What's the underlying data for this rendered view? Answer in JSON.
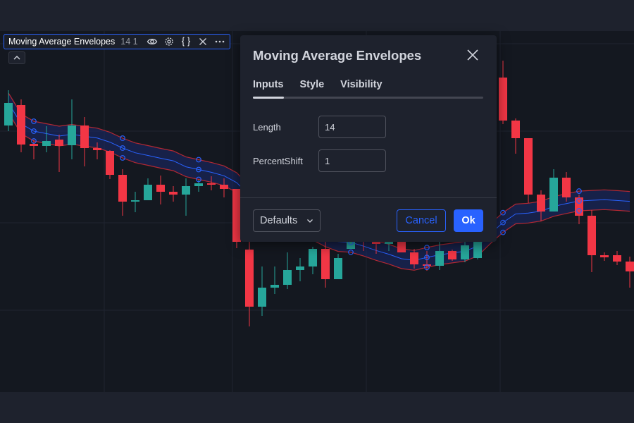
{
  "legend": {
    "name": "Moving Average Envelopes",
    "params": "14 1",
    "icons": [
      "eye-icon",
      "gear-icon",
      "code-braces-icon",
      "close-icon",
      "more-icon"
    ]
  },
  "dialog": {
    "title": "Moving Average Envelopes",
    "tabs": [
      {
        "label": "Inputs",
        "active": true
      },
      {
        "label": "Style",
        "active": false
      },
      {
        "label": "Visibility",
        "active": false
      }
    ],
    "fields": [
      {
        "label": "Length",
        "value": "14"
      },
      {
        "label": "PercentShift",
        "value": "1"
      }
    ],
    "defaults_label": "Defaults",
    "cancel_label": "Cancel",
    "ok_label": "Ok"
  },
  "colors": {
    "bull": "#26a69a",
    "bear": "#f23645",
    "envelope": "#b22833",
    "band_fill": "#1a2a6c",
    "basis": "#2962ff",
    "accent": "#2962ff",
    "dialog_bg": "#1e222d",
    "chart_bg": "#141820"
  },
  "chart_data": {
    "type": "candlestick",
    "y_axis": "price (unlabeled)",
    "candles": [
      {
        "o": 128,
        "c": 160,
        "h": 178,
        "l": 120
      },
      {
        "o": 157,
        "c": 101,
        "h": 165,
        "l": 90
      },
      {
        "o": 102,
        "c": 99,
        "h": 108,
        "l": 80
      },
      {
        "o": 99,
        "c": 106,
        "h": 127,
        "l": 90
      },
      {
        "o": 108,
        "c": 99,
        "h": 115,
        "l": 62
      },
      {
        "o": 100,
        "c": 128,
        "h": 165,
        "l": 80
      },
      {
        "o": 128,
        "c": 96,
        "h": 140,
        "l": 70
      },
      {
        "o": 96,
        "c": 93,
        "h": 104,
        "l": 80
      },
      {
        "o": 92,
        "c": 58,
        "h": 93,
        "l": 52
      },
      {
        "o": 58,
        "c": 20,
        "h": 66,
        "l": 0
      },
      {
        "o": 20,
        "c": 22,
        "h": 34,
        "l": 5
      },
      {
        "o": 22,
        "c": 44,
        "h": 53,
        "l": 22
      },
      {
        "o": 44,
        "c": 34,
        "h": 57,
        "l": 16
      },
      {
        "o": 34,
        "c": 30,
        "h": 42,
        "l": 20
      },
      {
        "o": 30,
        "c": 42,
        "h": 53,
        "l": 0
      },
      {
        "o": 42,
        "c": 46,
        "h": 51,
        "l": 34
      },
      {
        "o": 46,
        "c": 44,
        "h": 56,
        "l": 36
      },
      {
        "o": 44,
        "c": 38,
        "h": 53,
        "l": 26
      },
      {
        "o": 38,
        "c": -37,
        "h": 38,
        "l": -46
      },
      {
        "o": -48,
        "c": -129,
        "h": -14,
        "l": -157
      },
      {
        "o": -129,
        "c": -102,
        "h": -72,
        "l": -142
      },
      {
        "o": -102,
        "c": -98,
        "h": -72,
        "l": -111
      },
      {
        "o": -98,
        "c": -77,
        "h": -52,
        "l": -104
      },
      {
        "o": -77,
        "c": -72,
        "h": -60,
        "l": -93
      },
      {
        "o": -72,
        "c": -47,
        "h": -44,
        "l": -83
      },
      {
        "o": -47,
        "c": -90,
        "h": -35,
        "l": -102
      },
      {
        "o": -90,
        "c": -60,
        "h": -54,
        "l": -90
      },
      {
        "o": -47,
        "c": 13,
        "h": 21,
        "l": -47
      },
      {
        "o": 13,
        "c": -33,
        "h": 21,
        "l": -50
      },
      {
        "o": 13,
        "c": -40,
        "h": 18,
        "l": -54
      },
      {
        "o": -40,
        "c": -30,
        "h": -14,
        "l": -50
      },
      {
        "o": -30,
        "c": -52,
        "h": -6,
        "l": -52
      },
      {
        "o": -52,
        "c": -69,
        "h": -47,
        "l": -75
      },
      {
        "o": -69,
        "c": -71,
        "h": -50,
        "l": -78
      },
      {
        "o": -71,
        "c": -50,
        "h": -35,
        "l": -77
      },
      {
        "o": -50,
        "c": -62,
        "h": -48,
        "l": -64
      },
      {
        "o": -62,
        "c": -42,
        "h": -35,
        "l": -66
      },
      {
        "o": -60,
        "c": 30,
        "h": 30,
        "l": -62
      },
      {
        "o": 130,
        "c": 196,
        "h": 220,
        "l": 30
      },
      {
        "o": 196,
        "c": 135,
        "h": 220,
        "l": 130
      },
      {
        "o": 135,
        "c": 110,
        "h": 138,
        "l": 88
      },
      {
        "o": 110,
        "c": 30,
        "h": 110,
        "l": 18
      },
      {
        "o": 30,
        "c": 6,
        "h": 36,
        "l": -8
      },
      {
        "o": 6,
        "c": 54,
        "h": 66,
        "l": 6
      },
      {
        "o": 54,
        "c": 26,
        "h": 62,
        "l": 20
      },
      {
        "o": 26,
        "c": 0,
        "h": 30,
        "l": -12
      },
      {
        "o": 0,
        "c": -56,
        "h": 8,
        "l": -80
      },
      {
        "o": -56,
        "c": -59,
        "h": -52,
        "l": -64
      },
      {
        "o": -56,
        "c": -65,
        "h": -50,
        "l": -70
      },
      {
        "o": -65,
        "c": -79,
        "h": -58,
        "l": -102
      }
    ]
  }
}
